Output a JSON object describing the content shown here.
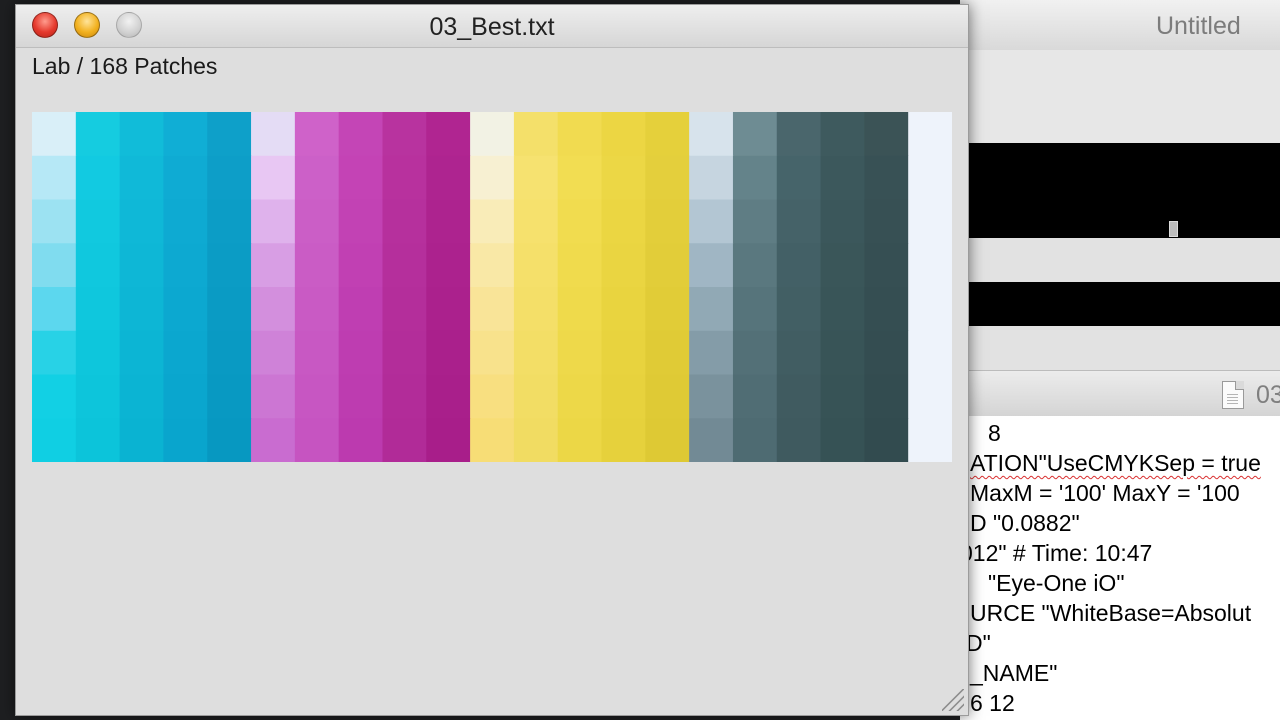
{
  "front_window": {
    "title": "03_Best.txt",
    "caption": "Lab / 168 Patches"
  },
  "back_window": {
    "title": "Untitled",
    "tab_label": "03",
    "text_lines": [
      "8",
      "ATION\"UseCMYKSep = true",
      "MaxM = '100' MaxY = '100",
      "D \"0.0882\"",
      "012\"  # Time: 10:47",
      "\"Eye-One iO\"",
      "URCE   \"WhiteBase=Absolut",
      "D\"",
      "_NAME\"",
      "6  12"
    ]
  },
  "patches": {
    "columns": 21,
    "rows": 8,
    "colors": [
      [
        "#d9eff8",
        "#15cce0",
        "#11bcd9",
        "#10aed5",
        "#0ea0c9",
        "#e4dcf5",
        "#cf62c9",
        "#c445b6",
        "#b8339f",
        "#b02591",
        "#f2f2e4",
        "#f4e06a",
        "#f1db50",
        "#ecd643",
        "#e5d03b",
        "#d7e3ec",
        "#6e8c93",
        "#4a666c",
        "#3e5a5e",
        "#3b5356",
        "#eef3fb"
      ],
      [
        "#b6e8f6",
        "#12cae1",
        "#10b9d8",
        "#0fabd3",
        "#0d9ec8",
        "#e8c7f3",
        "#cc60c8",
        "#c443b5",
        "#b8319e",
        "#ae2490",
        "#f7f0d2",
        "#f6e270",
        "#f2dd52",
        "#ecd745",
        "#e4cf3c",
        "#c6d5e0",
        "#64838a",
        "#46646a",
        "#3c585c",
        "#385155",
        "#eef3fb"
      ],
      [
        "#9ce2f2",
        "#11c9df",
        "#0fb8d7",
        "#0eaad2",
        "#0c9dc6",
        "#dfb2ec",
        "#cb5ec6",
        "#c242b4",
        "#b6309d",
        "#ad238f",
        "#f9ecb8",
        "#f6e16d",
        "#f1dc4f",
        "#ebd642",
        "#e3ce3a",
        "#b3c6d3",
        "#5f7d84",
        "#456268",
        "#3b575b",
        "#375054",
        "#eef3fb"
      ],
      [
        "#80dcef",
        "#10c8de",
        "#0eb7d6",
        "#0da9d1",
        "#0b9cc5",
        "#d89ee4",
        "#ca5cc5",
        "#c140b3",
        "#b52f9c",
        "#ac228e",
        "#f9e8a6",
        "#f5e06a",
        "#f0db4d",
        "#ead541",
        "#e2cd39",
        "#a0b6c4",
        "#5a787f",
        "#436066",
        "#3a5659",
        "#364f53",
        "#eef3fb"
      ],
      [
        "#5cd7ee",
        "#0fc7dd",
        "#0db6d5",
        "#0ca8d0",
        "#0a9bc4",
        "#d38fdd",
        "#c95ac4",
        "#bf3eb2",
        "#b42e9b",
        "#ab218d",
        "#f9e498",
        "#f4df68",
        "#efda4b",
        "#e9d43f",
        "#e1cc37",
        "#91a9b5",
        "#56747b",
        "#425f64",
        "#395558",
        "#354e52",
        "#eef3fb"
      ],
      [
        "#28d2e6",
        "#0ec6dc",
        "#0cb5d4",
        "#0ba7cf",
        "#099ac3",
        "#cf82d8",
        "#c858c3",
        "#be3db1",
        "#b32d9a",
        "#aa208c",
        "#f8e28c",
        "#f3de66",
        "#eed94a",
        "#e8d33e",
        "#e0cb36",
        "#849ca8",
        "#537077",
        "#415d62",
        "#385457",
        "#344d51",
        "#eef3fb"
      ],
      [
        "#12d0e4",
        "#0dc5db",
        "#0bb4d3",
        "#0aa6ce",
        "#0899c2",
        "#cc76d3",
        "#c756c2",
        "#bd3cb0",
        "#b22c99",
        "#a91f8b",
        "#f8df80",
        "#f2dd64",
        "#edd848",
        "#e7d23d",
        "#dfca35",
        "#7a929d",
        "#506d74",
        "#405b60",
        "#375356",
        "#334c50",
        "#eef3fb"
      ],
      [
        "#10cfe3",
        "#0cc4da",
        "#0ab3d2",
        "#09a5cd",
        "#0798c1",
        "#c96cd0",
        "#c654c1",
        "#bc3aaf",
        "#b12b98",
        "#a81e8a",
        "#f7dd76",
        "#f1dc62",
        "#ecd746",
        "#e6d13c",
        "#dec934",
        "#728a95",
        "#4e6b72",
        "#3f5a5f",
        "#365255",
        "#324b4f",
        "#eef3fb"
      ]
    ]
  }
}
